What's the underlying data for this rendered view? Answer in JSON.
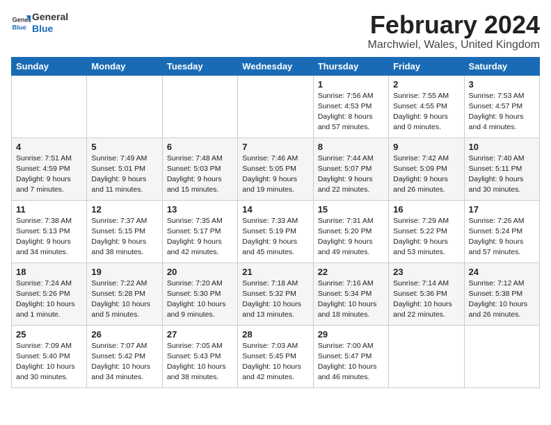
{
  "logo": {
    "line1": "General",
    "line2": "Blue"
  },
  "title": "February 2024",
  "location": "Marchwiel, Wales, United Kingdom",
  "weekdays": [
    "Sunday",
    "Monday",
    "Tuesday",
    "Wednesday",
    "Thursday",
    "Friday",
    "Saturday"
  ],
  "weeks": [
    [
      {
        "day": "",
        "info": ""
      },
      {
        "day": "",
        "info": ""
      },
      {
        "day": "",
        "info": ""
      },
      {
        "day": "",
        "info": ""
      },
      {
        "day": "1",
        "info": "Sunrise: 7:56 AM\nSunset: 4:53 PM\nDaylight: 8 hours\nand 57 minutes."
      },
      {
        "day": "2",
        "info": "Sunrise: 7:55 AM\nSunset: 4:55 PM\nDaylight: 9 hours\nand 0 minutes."
      },
      {
        "day": "3",
        "info": "Sunrise: 7:53 AM\nSunset: 4:57 PM\nDaylight: 9 hours\nand 4 minutes."
      }
    ],
    [
      {
        "day": "4",
        "info": "Sunrise: 7:51 AM\nSunset: 4:59 PM\nDaylight: 9 hours\nand 7 minutes."
      },
      {
        "day": "5",
        "info": "Sunrise: 7:49 AM\nSunset: 5:01 PM\nDaylight: 9 hours\nand 11 minutes."
      },
      {
        "day": "6",
        "info": "Sunrise: 7:48 AM\nSunset: 5:03 PM\nDaylight: 9 hours\nand 15 minutes."
      },
      {
        "day": "7",
        "info": "Sunrise: 7:46 AM\nSunset: 5:05 PM\nDaylight: 9 hours\nand 19 minutes."
      },
      {
        "day": "8",
        "info": "Sunrise: 7:44 AM\nSunset: 5:07 PM\nDaylight: 9 hours\nand 22 minutes."
      },
      {
        "day": "9",
        "info": "Sunrise: 7:42 AM\nSunset: 5:09 PM\nDaylight: 9 hours\nand 26 minutes."
      },
      {
        "day": "10",
        "info": "Sunrise: 7:40 AM\nSunset: 5:11 PM\nDaylight: 9 hours\nand 30 minutes."
      }
    ],
    [
      {
        "day": "11",
        "info": "Sunrise: 7:38 AM\nSunset: 5:13 PM\nDaylight: 9 hours\nand 34 minutes."
      },
      {
        "day": "12",
        "info": "Sunrise: 7:37 AM\nSunset: 5:15 PM\nDaylight: 9 hours\nand 38 minutes."
      },
      {
        "day": "13",
        "info": "Sunrise: 7:35 AM\nSunset: 5:17 PM\nDaylight: 9 hours\nand 42 minutes."
      },
      {
        "day": "14",
        "info": "Sunrise: 7:33 AM\nSunset: 5:19 PM\nDaylight: 9 hours\nand 45 minutes."
      },
      {
        "day": "15",
        "info": "Sunrise: 7:31 AM\nSunset: 5:20 PM\nDaylight: 9 hours\nand 49 minutes."
      },
      {
        "day": "16",
        "info": "Sunrise: 7:29 AM\nSunset: 5:22 PM\nDaylight: 9 hours\nand 53 minutes."
      },
      {
        "day": "17",
        "info": "Sunrise: 7:26 AM\nSunset: 5:24 PM\nDaylight: 9 hours\nand 57 minutes."
      }
    ],
    [
      {
        "day": "18",
        "info": "Sunrise: 7:24 AM\nSunset: 5:26 PM\nDaylight: 10 hours\nand 1 minute."
      },
      {
        "day": "19",
        "info": "Sunrise: 7:22 AM\nSunset: 5:28 PM\nDaylight: 10 hours\nand 5 minutes."
      },
      {
        "day": "20",
        "info": "Sunrise: 7:20 AM\nSunset: 5:30 PM\nDaylight: 10 hours\nand 9 minutes."
      },
      {
        "day": "21",
        "info": "Sunrise: 7:18 AM\nSunset: 5:32 PM\nDaylight: 10 hours\nand 13 minutes."
      },
      {
        "day": "22",
        "info": "Sunrise: 7:16 AM\nSunset: 5:34 PM\nDaylight: 10 hours\nand 18 minutes."
      },
      {
        "day": "23",
        "info": "Sunrise: 7:14 AM\nSunset: 5:36 PM\nDaylight: 10 hours\nand 22 minutes."
      },
      {
        "day": "24",
        "info": "Sunrise: 7:12 AM\nSunset: 5:38 PM\nDaylight: 10 hours\nand 26 minutes."
      }
    ],
    [
      {
        "day": "25",
        "info": "Sunrise: 7:09 AM\nSunset: 5:40 PM\nDaylight: 10 hours\nand 30 minutes."
      },
      {
        "day": "26",
        "info": "Sunrise: 7:07 AM\nSunset: 5:42 PM\nDaylight: 10 hours\nand 34 minutes."
      },
      {
        "day": "27",
        "info": "Sunrise: 7:05 AM\nSunset: 5:43 PM\nDaylight: 10 hours\nand 38 minutes."
      },
      {
        "day": "28",
        "info": "Sunrise: 7:03 AM\nSunset: 5:45 PM\nDaylight: 10 hours\nand 42 minutes."
      },
      {
        "day": "29",
        "info": "Sunrise: 7:00 AM\nSunset: 5:47 PM\nDaylight: 10 hours\nand 46 minutes."
      },
      {
        "day": "",
        "info": ""
      },
      {
        "day": "",
        "info": ""
      }
    ]
  ],
  "accent_color": "#1a6bb5"
}
